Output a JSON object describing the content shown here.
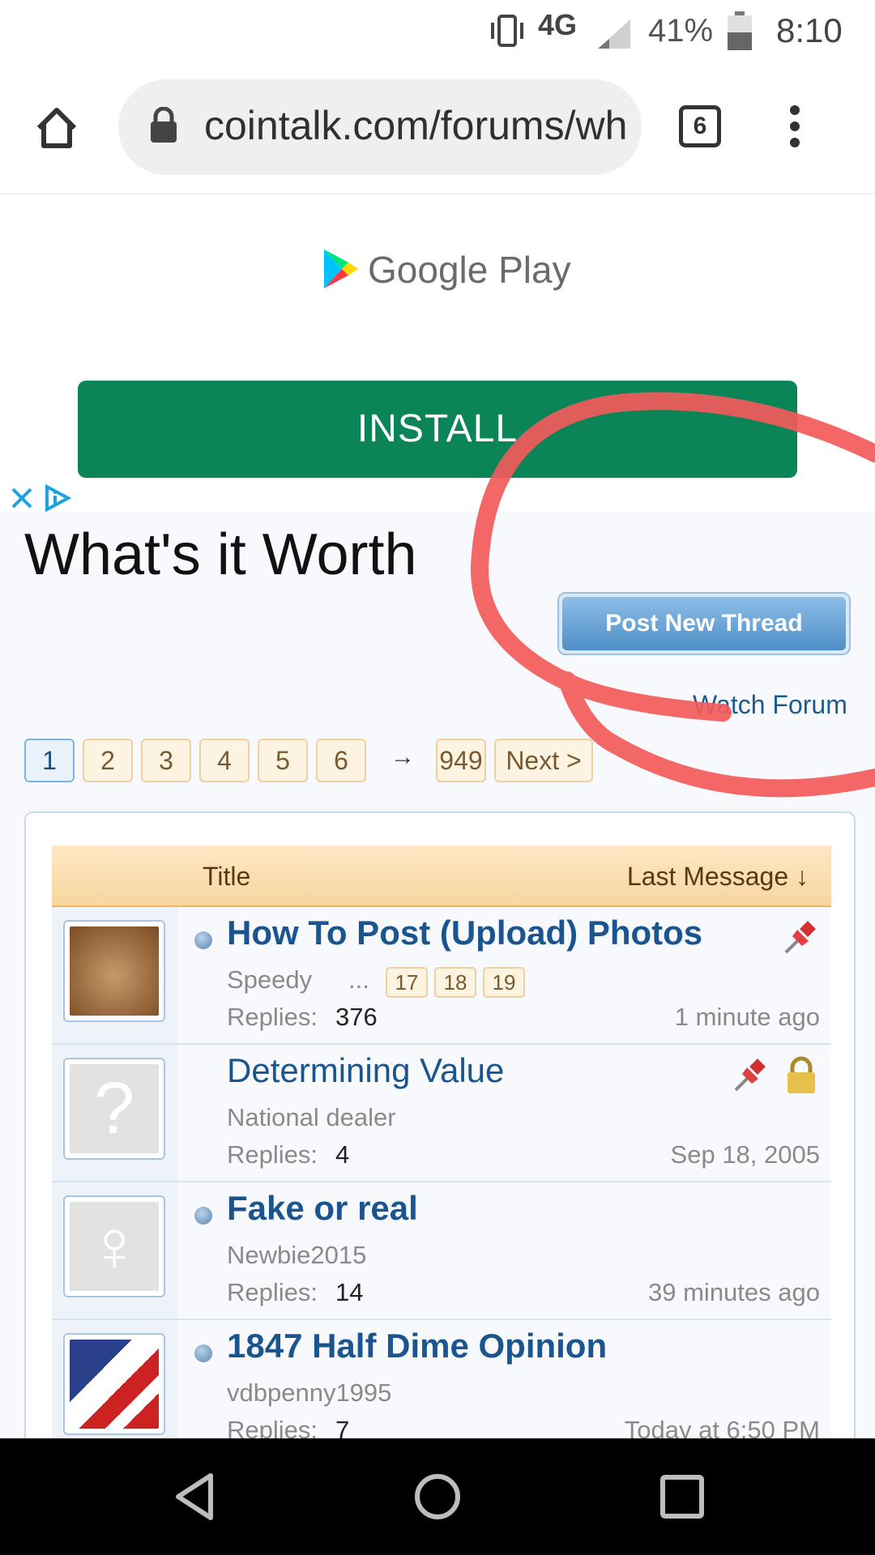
{
  "status_bar": {
    "network": "4G",
    "battery": "41%",
    "time": "8:10"
  },
  "browser": {
    "url": "cointalk.com/forums/wh",
    "tab_count": "6"
  },
  "ad": {
    "brand": "Google Play",
    "install_label": "INSTALL"
  },
  "forum": {
    "title": "What's it Worth",
    "post_button": "Post New Thread",
    "watch_label": "Watch Forum",
    "pages": [
      "1",
      "2",
      "3",
      "4",
      "5",
      "6"
    ],
    "pager_arrow": "→",
    "last_page": "949",
    "next_label": "Next >",
    "header": {
      "title": "Title",
      "last_message": "Last Message ↓"
    },
    "threads": [
      {
        "title": "How To Post (Upload) Photos",
        "author": "Speedy",
        "ellipsis": "...",
        "pages": [
          "17",
          "18",
          "19"
        ],
        "replies_label": "Replies:",
        "replies": "376",
        "date": "1 minute ago"
      },
      {
        "title": "Determining Value",
        "author": "National dealer",
        "replies_label": "Replies:",
        "replies": "4",
        "date": "Sep 18, 2005"
      },
      {
        "title": "Fake or real",
        "author": "Newbie2015",
        "replies_label": "Replies:",
        "replies": "14",
        "date": "39 minutes ago"
      },
      {
        "title": "1847 Half Dime Opinion",
        "author": "vdbpenny1995",
        "replies_label": "Replies:",
        "replies": "7",
        "date": "Today at 6:50 PM"
      }
    ]
  },
  "colors": {
    "install_green": "#0b8457",
    "link_blue": "#1b5590",
    "annotation_red": "#f25a5a",
    "header_orange": "#f9d6a0"
  }
}
